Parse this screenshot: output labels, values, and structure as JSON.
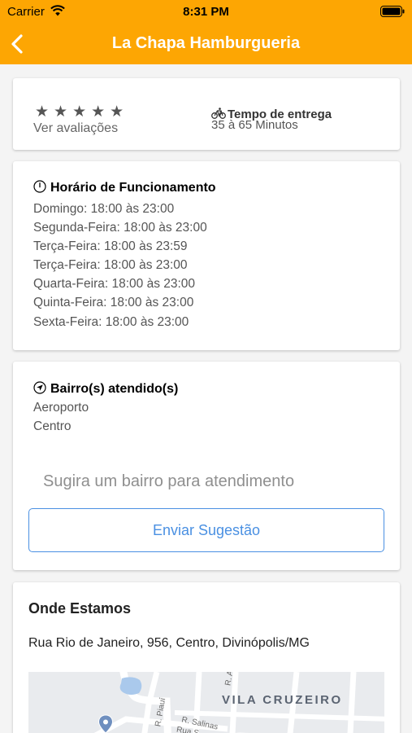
{
  "status_bar": {
    "carrier": "Carrier",
    "time": "8:31 PM"
  },
  "nav": {
    "title": "La Chapa Hamburgueria",
    "back_icon": "chevron-left-icon"
  },
  "colors": {
    "brand": "#fda603",
    "accent": "#4a90e2"
  },
  "rating": {
    "stars": "★★★★★",
    "link": "Ver avaliações"
  },
  "delivery": {
    "title": "Tempo de entrega",
    "value": "35 à 65 Minutos"
  },
  "hours": {
    "title": "Horário de Funcionamento",
    "items": [
      "Domingo: 18:00 às 23:00",
      "Segunda-Feira: 18:00 às 23:00",
      "Terça-Feira: 18:00 às 23:59",
      "Terça-Feira: 18:00 às 23:00",
      "Quarta-Feira: 18:00 às 23:00",
      "Quinta-Feira: 18:00 às 23:00",
      "Sexta-Feira: 18:00 às 23:00"
    ]
  },
  "neighborhoods": {
    "title": "Bairro(s) atendido(s)",
    "items": [
      "Aeroporto",
      "Centro"
    ],
    "suggest_placeholder": "Sugira um bairro para atendimento",
    "send_label": "Enviar Sugestão"
  },
  "location": {
    "title": "Onde Estamos",
    "address": "Rua Rio de Janeiro, 956, Centro, Divinópolis/MG",
    "map": {
      "district": "VILA CRUZEIRO",
      "streets": [
        "R. Piauí",
        "R. Salinas",
        "Rua S",
        "R. A"
      ]
    }
  }
}
